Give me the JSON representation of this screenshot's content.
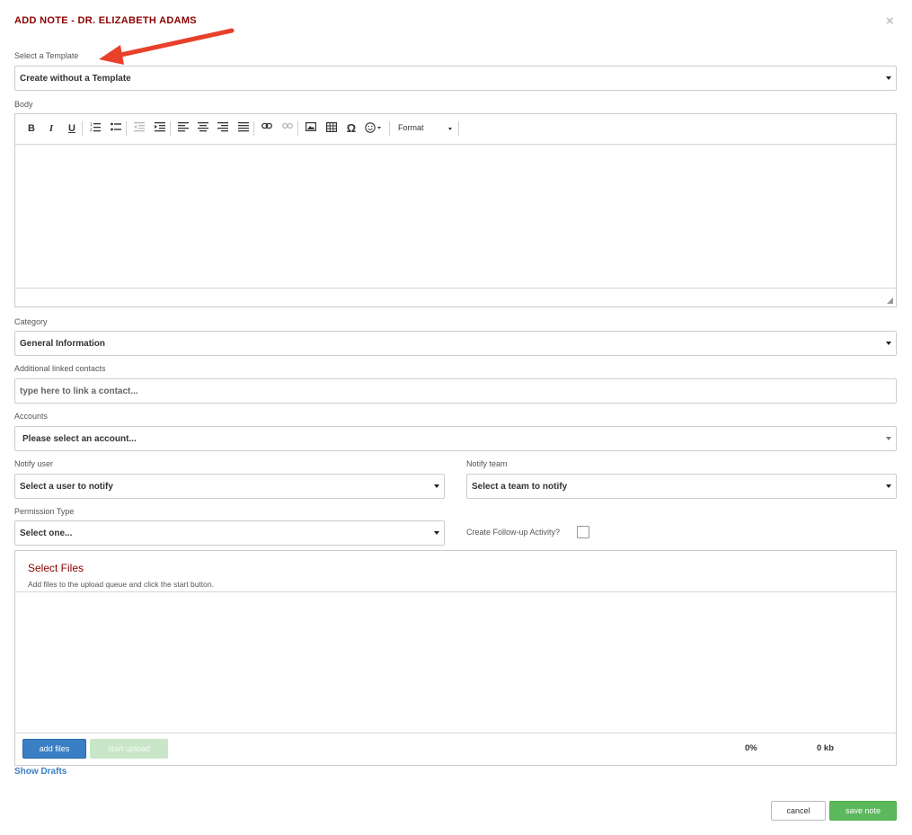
{
  "dialog": {
    "title": "ADD NOTE - DR. ELIZABETH ADAMS",
    "close_glyph": "×"
  },
  "template": {
    "label": "Select a Template",
    "value": "Create without a Template"
  },
  "body": {
    "label": "Body",
    "toolbar": {
      "bold": "B",
      "italic": "I",
      "underline": "U",
      "special_char": "Ω",
      "format_label": "Format"
    }
  },
  "category": {
    "label": "Category",
    "value": "General Information"
  },
  "linked_contacts": {
    "label": "Additional linked contacts",
    "placeholder": "type here to link a contact..."
  },
  "accounts": {
    "label": "Accounts",
    "value": "Please select an account..."
  },
  "notify_user": {
    "label": "Notify user",
    "value": "Select a user to notify"
  },
  "notify_team": {
    "label": "Notify team",
    "value": "Select a team to notify"
  },
  "permission": {
    "label": "Permission Type",
    "value": "Select one..."
  },
  "follow_up": {
    "label": "Create Follow-up Activity?"
  },
  "uploader": {
    "title": "Select Files",
    "subtitle": "Add files to the upload queue and click the start button.",
    "add_label": "add files",
    "start_label": "start upload",
    "percent": "0%",
    "size": "0 kb"
  },
  "drafts_link": "Show Drafts",
  "actions": {
    "cancel_label": "cancel",
    "save_label": "save note"
  },
  "colors": {
    "title": "#8b0000",
    "primary": "#3a7fc4",
    "success": "#5cb85c",
    "annotation_arrow": "#e8402a"
  }
}
